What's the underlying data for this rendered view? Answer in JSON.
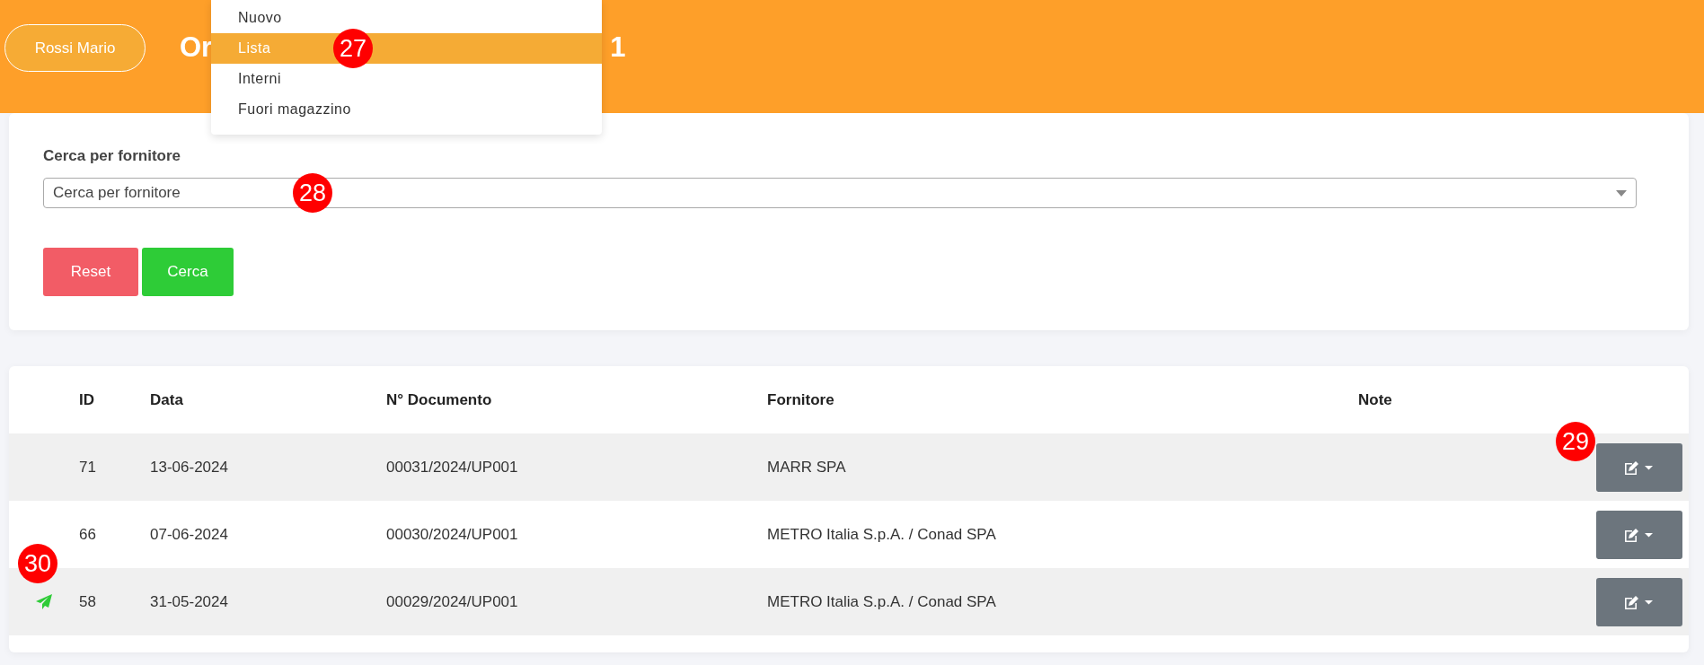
{
  "header": {
    "user_button": "Rossi Mario",
    "title_start": "Or",
    "title_end": "1"
  },
  "menu": {
    "items": [
      {
        "label": "Nuovo",
        "selected": false
      },
      {
        "label": "Lista",
        "selected": true,
        "callout": "27"
      },
      {
        "label": "Interni",
        "selected": false
      },
      {
        "label": "Fuori magazzino",
        "selected": false
      }
    ]
  },
  "search": {
    "label": "Cerca per fornitore",
    "placeholder": "Cerca per fornitore",
    "callout": "28",
    "buttons": [
      {
        "label": "Reset",
        "kind": "reset"
      },
      {
        "label": "Cerca",
        "kind": "search"
      }
    ]
  },
  "table": {
    "columns": [
      "ID",
      "Data",
      "N° Documento",
      "Fornitore",
      "Note"
    ],
    "rows": [
      {
        "sent": false,
        "id": "71",
        "data": "13-06-2024",
        "documento": "00031/2024/UP001",
        "fornitore": "MARR SPA",
        "action_callout": "29"
      },
      {
        "sent": false,
        "id": "66",
        "data": "07-06-2024",
        "documento": "00030/2024/UP001",
        "fornitore": "METRO Italia S.p.A. / Conad SPA"
      },
      {
        "sent": true,
        "id": "58",
        "data": "31-05-2024",
        "documento": "00029/2024/UP001",
        "fornitore": "METRO Italia S.p.A. / Conad SPA",
        "icon_callout": "30"
      }
    ]
  }
}
